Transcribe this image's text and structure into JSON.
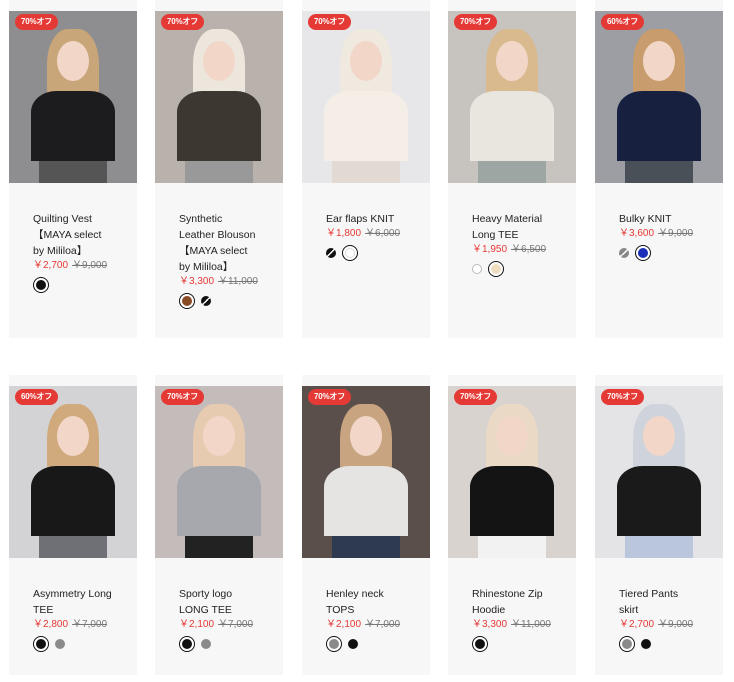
{
  "products": [
    {
      "badge": "70%オフ",
      "name": "Quilting Vest\n【MAYA select by Mililoa】",
      "name_lines": [
        "Quilting Vest",
        "【MAYA select",
        "by Mililoa】"
      ],
      "price": "￥2,700",
      "original_price": "￥9,000",
      "swatches": [
        {
          "color": "#111111",
          "selected": true
        }
      ],
      "photo": {
        "bg": "#8e8e90",
        "hair": "#c9a57a",
        "top": "#1c1c1e",
        "bottom": "#555"
      }
    },
    {
      "badge": "70%オフ",
      "name_lines": [
        "Synthetic",
        "Leather Blouson",
        "【MAYA select",
        "by Mililoa】"
      ],
      "price": "￥3,300",
      "original_price": "￥11,000",
      "swatches": [
        {
          "color": "#8a4a25",
          "selected": true
        },
        {
          "color": "split",
          "selected": false
        }
      ],
      "photo": {
        "bg": "#b9b2ac",
        "hair": "#ece6dc",
        "top": "#3d3731",
        "bottom": "#999"
      }
    },
    {
      "badge": "70%オフ",
      "name_lines": [
        "Ear flaps KNIT"
      ],
      "price": "￥1,800",
      "original_price": "￥6,000",
      "swatches": [
        {
          "color": "split",
          "selected": false
        },
        {
          "color": "#ffffff",
          "selected": true
        }
      ],
      "photo": {
        "bg": "#e7e6e8",
        "hair": "#efe9df",
        "top": "#f4eee7",
        "bottom": "#e2d9d3"
      }
    },
    {
      "badge": "70%オフ",
      "name_lines": [
        "Heavy Material",
        "Long TEE"
      ],
      "price": "￥1,950",
      "original_price": "￥6,500",
      "swatches": [
        {
          "color": "#ffffff",
          "selected": false
        },
        {
          "color": "#eedfc1",
          "selected": true
        }
      ],
      "photo": {
        "bg": "#c7c4c0",
        "hair": "#d9b98e",
        "top": "#e9e5df",
        "bottom": "#9da6a2"
      }
    },
    {
      "badge": "60%オフ",
      "name_lines": [
        "Bulky KNIT"
      ],
      "price": "￥3,600",
      "original_price": "￥9,000",
      "swatches": [
        {
          "color": "split-gray",
          "selected": false
        },
        {
          "color": "#1b2fb8",
          "selected": true
        }
      ],
      "photo": {
        "bg": "#9c9ea3",
        "hair": "#c89c6c",
        "top": "#17203f",
        "bottom": "#4a5058"
      }
    },
    {
      "badge": "60%オフ",
      "name_lines": [
        "Asymmetry Long",
        "TEE"
      ],
      "price": "￥2,800",
      "original_price": "￥7,000",
      "swatches": [
        {
          "color": "#111111",
          "selected": true
        },
        {
          "color": "#8a8a8a",
          "selected": false
        }
      ],
      "photo": {
        "bg": "#d3d3d6",
        "hair": "#d0a97c",
        "top": "#181818",
        "bottom": "#6f7076"
      }
    },
    {
      "badge": "70%オフ",
      "name_lines": [
        "Sporty logo",
        "LONG TEE"
      ],
      "price": "￥2,100",
      "original_price": "￥7,000",
      "swatches": [
        {
          "color": "#111111",
          "selected": true
        },
        {
          "color": "#8a8a8a",
          "selected": false
        }
      ],
      "photo": {
        "bg": "#c3bcba",
        "hair": "#e6cbb1",
        "top": "#a6a8ad",
        "bottom": "#222"
      }
    },
    {
      "badge": "70%オフ",
      "name_lines": [
        "Henley neck",
        "TOPS"
      ],
      "price": "￥2,100",
      "original_price": "￥7,000",
      "swatches": [
        {
          "color": "#8a8a8a",
          "selected": true
        },
        {
          "color": "#111111",
          "selected": false
        }
      ],
      "photo": {
        "bg": "#5a4f4b",
        "hair": "#c8a481",
        "top": "#e6e4e2",
        "bottom": "#2d3a4f"
      }
    },
    {
      "badge": "70%オフ",
      "name_lines": [
        "Rhinestone Zip",
        "Hoodie"
      ],
      "price": "￥3,300",
      "original_price": "￥11,000",
      "swatches": [
        {
          "color": "#111111",
          "selected": true
        }
      ],
      "photo": {
        "bg": "#d8d3ce",
        "hair": "#ead9c4",
        "top": "#141414",
        "bottom": "#f2f2f2"
      }
    },
    {
      "badge": "70%オフ",
      "name_lines": [
        "Tiered Pants",
        "skirt"
      ],
      "price": "￥2,700",
      "original_price": "￥9,000",
      "swatches": [
        {
          "color": "#8a8a8a",
          "selected": true
        },
        {
          "color": "#111111",
          "selected": false
        }
      ],
      "photo": {
        "bg": "#e4e4e6",
        "hair": "#cfd4dc",
        "top": "#1a1a1a",
        "bottom": "#b9c6dc"
      }
    }
  ]
}
